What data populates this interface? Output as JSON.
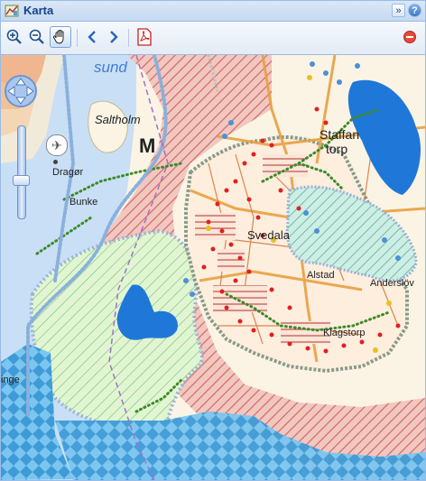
{
  "window": {
    "title": "Karta"
  },
  "titlebar": {
    "collapse_icon": "double-chevron-right-icon",
    "help_icon": "question-icon"
  },
  "toolbar": {
    "tools": [
      "zoom-in-icon",
      "zoom-out-icon",
      "pan-hand-icon",
      "back-arrow-icon",
      "forward-arrow-icon",
      "pdf-icon",
      "close-red-icon"
    ],
    "active_tool": "pan-hand-icon"
  },
  "map": {
    "labels": {
      "sund": "sund",
      "saltholm": "Saltholm",
      "m": "M",
      "dragor": "Dragør",
      "bunkeflo": "Bunke",
      "svedala": "Svedala",
      "staffanstorp_1": "Staffan",
      "staffanstorp_2": "torp",
      "alstad": "Alstad",
      "anderslov": "Anderslöv",
      "klagstorp": "Klagstorp",
      "ingelsta": "inge"
    },
    "colors": {
      "sea": "#c9dff5",
      "land": "#fbf4e4",
      "urban": "#f0a070",
      "hatch_red": "#e07070",
      "hatch_green": "#7dc67d",
      "hatch_teal": "#6fb8a8",
      "lake": "#1f78d8",
      "natura_blue": "#4d8fd9"
    }
  }
}
